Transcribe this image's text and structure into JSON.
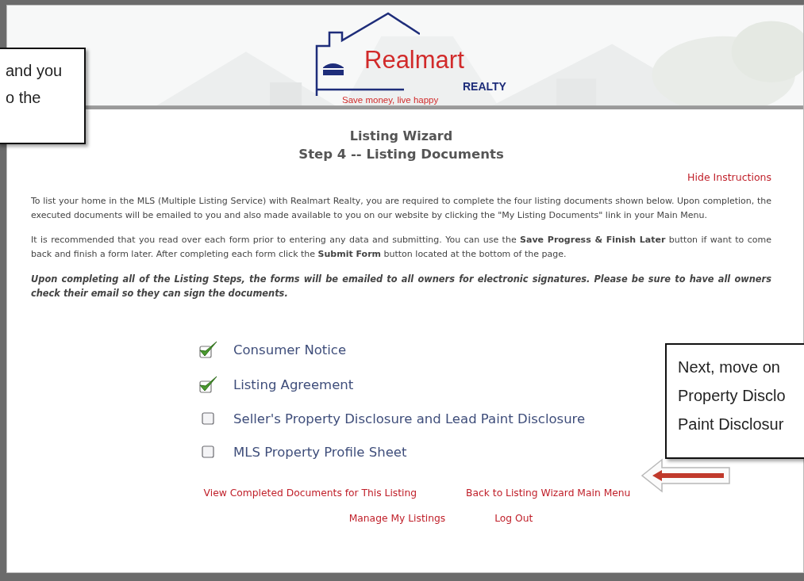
{
  "header": {
    "brand": "Realmart",
    "brand_sub": "REALTY",
    "tagline": "Save money, live happy"
  },
  "title": "Listing Wizard",
  "subtitle": "Step 4 -- Listing Documents",
  "hide_link": "Hide Instructions",
  "paragraphs": [
    "To list your home in the MLS (Multiple Listing Service) with Realmart Realty, you are required to complete the four listing documents shown below. Upon completion, the executed documents will be emailed to you and also made available to you on our website by clicking the \"My Listing Documents\" link in your Main Menu.",
    "It is recommended that you read over each form prior to entering any data and submitting. You can use the **Save Progress & Finish Later** button if want to come back and finish a form later. After completing each form click the **Submit Form** button located at the bottom of the page.",
    "Upon completing all of the Listing Steps, the forms will be emailed to all owners for electronic signatures. Please be sure to have all owners check their email so they can sign the documents."
  ],
  "documents": [
    {
      "label": "Consumer Notice",
      "checked": true
    },
    {
      "label": "Listing Agreement",
      "checked": true
    },
    {
      "label": "Seller's Property Disclosure and Lead Paint Disclosure",
      "checked": false
    },
    {
      "label": "MLS Property Profile Sheet",
      "checked": false
    }
  ],
  "links": [
    [
      "View Completed Documents for This Listing",
      "Back to Listing Wizard Main Menu"
    ],
    [
      "Manage My Listings",
      "Log Out"
    ]
  ],
  "callouts": [
    {
      "lines": [
        "and you",
        "o the"
      ]
    },
    {
      "lines": [
        "Next, move on",
        "Property Disclo",
        "Paint Disclosur"
      ]
    }
  ]
}
